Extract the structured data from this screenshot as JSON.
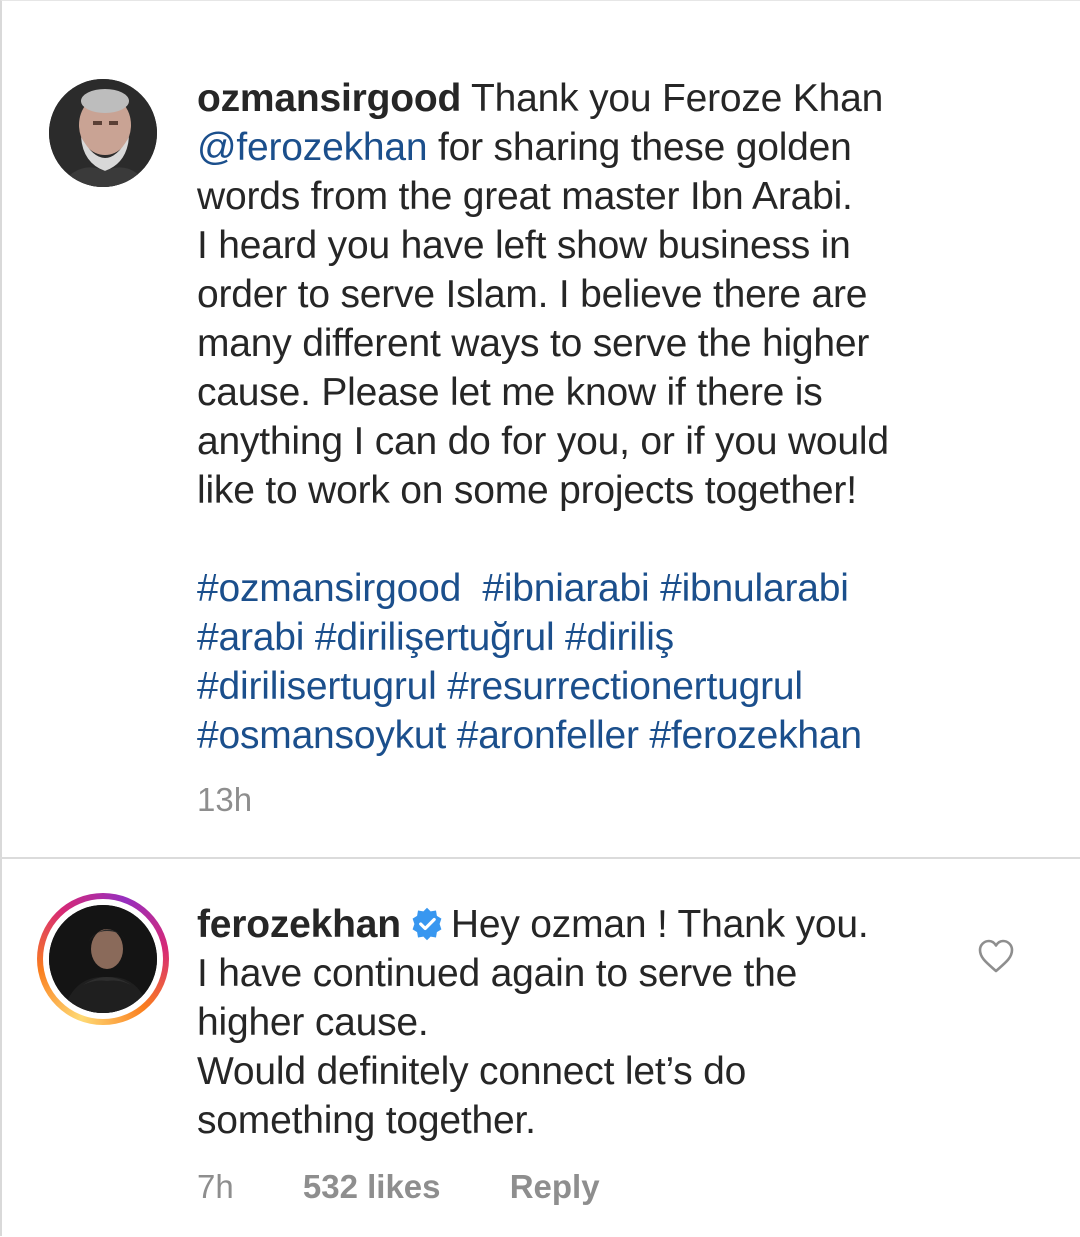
{
  "comments": [
    {
      "username": "ozmansirgood",
      "lines": [
        {
          "pre": " Thank you Feroze Khan"
        },
        {
          "mention": "@ferozekhan",
          "rest": " for sharing these golden"
        },
        {
          "text": "words from the great master Ibn Arabi."
        },
        {
          "text": "I heard you have left show business in"
        },
        {
          "text": "order to serve Islam. I believe there are"
        },
        {
          "text": "many different ways to serve the higher"
        },
        {
          "text": "cause. Please let me know if there is"
        },
        {
          "text": "anything I can do for you, or if you would"
        },
        {
          "text": "like to work on some projects together!"
        }
      ],
      "hashtag_lines": [
        "#ozmansirgood  #ibniarabi #ibnularabi",
        "#arabi #dirilişertuğrul #diriliş",
        "#dirilisertugrul #resurrectionertugrul",
        "#osmansoykut #aronfeller #ferozekhan"
      ],
      "time": "13h"
    },
    {
      "username": "ferozekhan",
      "verified_icon": "verified-badge-icon",
      "lines": [
        {
          "pre": "Hey ozman ! Thank you."
        },
        {
          "text": "I have continued again to serve the"
        },
        {
          "text": "higher cause."
        },
        {
          "text": "Would definitely connect let’s do"
        },
        {
          "text": "something together."
        }
      ],
      "time": "7h",
      "likes": "532 likes",
      "reply": "Reply",
      "like_icon": "heart-outline-icon"
    }
  ],
  "colors": {
    "text": "#262626",
    "link": "#1b4f8c",
    "muted": "#8e8e8e",
    "verified": "#3897f0",
    "divider": "#dbdbdb"
  }
}
